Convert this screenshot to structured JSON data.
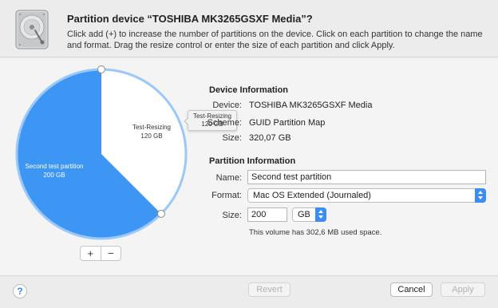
{
  "header": {
    "title": "Partition device “TOSHIBA MK3265GSXF Media”?",
    "description": "Click add (+) to increase the number of partitions on the device. Click on each partition to change the name and format. Drag the resize control or enter the size of each partition and click Apply."
  },
  "pie": {
    "partitions": [
      {
        "name": "Second test partition",
        "size": "200 GB",
        "value": 200,
        "color": "#3d96f4"
      },
      {
        "name": "Test-Resizing",
        "size": "120 GB",
        "value": 120,
        "color": "#ffffff"
      }
    ],
    "ring_color": "#9cc8f7",
    "tooltip": {
      "name": "Test-Resizing",
      "size": "120 GB"
    },
    "add_label": "+",
    "remove_label": "−"
  },
  "device_info": {
    "title": "Device Information",
    "device_label": "Device:",
    "device_value": "TOSHIBA MK3265GSXF Media",
    "scheme_label": "Scheme:",
    "scheme_value": "GUID Partition Map",
    "size_label": "Size:",
    "size_value": "320,07 GB"
  },
  "partition_info": {
    "title": "Partition Information",
    "name_label": "Name:",
    "name_value": "Second test partition",
    "format_label": "Format:",
    "format_value": "Mac OS Extended (Journaled)",
    "size_label": "Size:",
    "size_value": "200",
    "unit_value": "GB",
    "note": "This volume has 302,6 MB used space."
  },
  "footer": {
    "help_label": "?",
    "revert_label": "Revert",
    "cancel_label": "Cancel",
    "apply_label": "Apply"
  },
  "accent_color": "#3b8cf5"
}
